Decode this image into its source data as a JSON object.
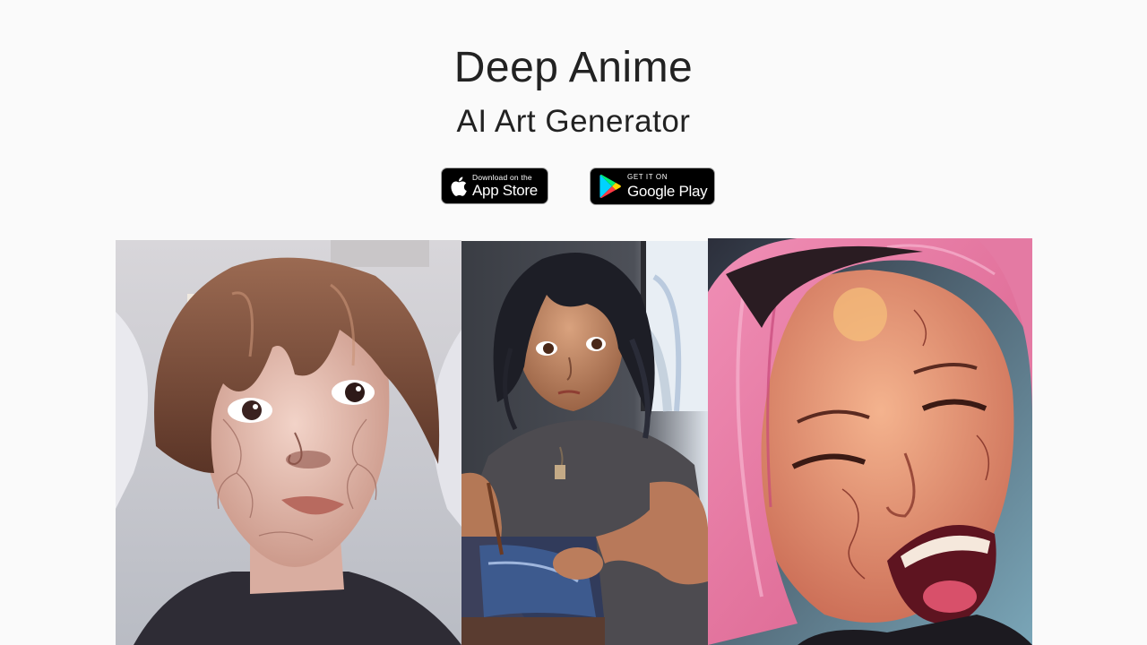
{
  "header": {
    "title": "Deep Anime",
    "subtitle": "AI Art Generator"
  },
  "store_badges": {
    "apple": {
      "small_label": "Download on the",
      "big_label": "App Store",
      "icon": "apple-logo-icon"
    },
    "google": {
      "small_label": "GET IT ON",
      "big_label": "Google Play",
      "icon": "google-play-logo-icon"
    }
  },
  "gallery": {
    "images": [
      {
        "subject": "anime portrait of young man with brown bangs and cracked skin"
      },
      {
        "subject": "anime woman with dark hair holding a drawing pen at a desk"
      },
      {
        "subject": "anime portrait of laughing woman with pink hair"
      }
    ]
  },
  "colors": {
    "background": "#fafafa",
    "text": "#222222",
    "badge_background": "#000000",
    "badge_border": "#a6a6a6"
  }
}
